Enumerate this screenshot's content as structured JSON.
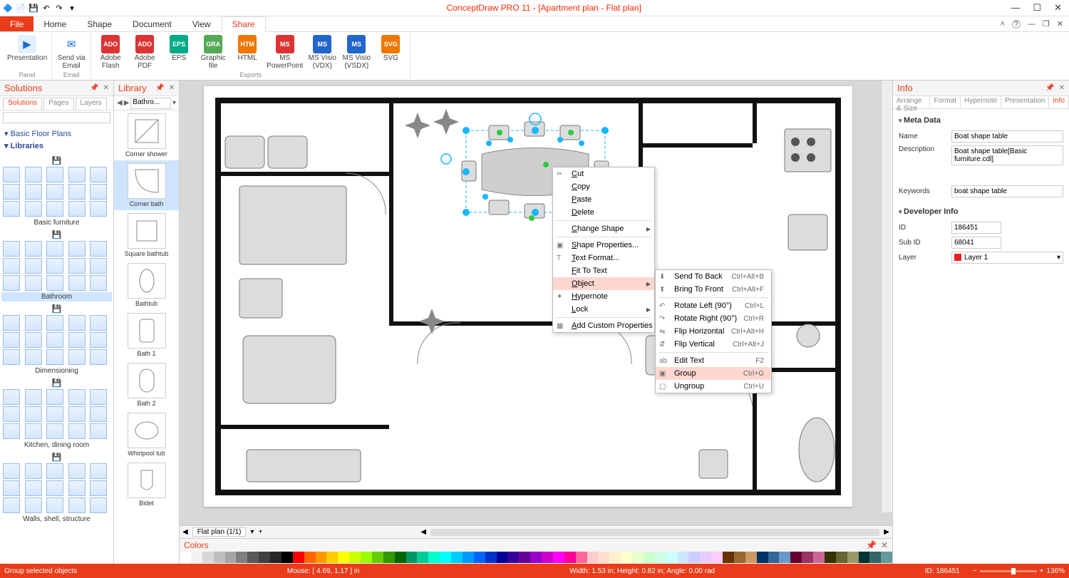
{
  "titlebar": {
    "title": "ConceptDraw PRO 11 - [Apartment plan - Flat plan]"
  },
  "tabs": {
    "file": "File",
    "items": [
      "Home",
      "Shape",
      "Document",
      "View",
      "Share"
    ],
    "active": "Share"
  },
  "ribbon": {
    "groups": [
      {
        "name": "Panel",
        "items": [
          {
            "label": "Presentation"
          }
        ]
      },
      {
        "name": "Email",
        "items": [
          {
            "label": "Send via\nEmail"
          }
        ]
      },
      {
        "name": "Exports",
        "items": [
          {
            "label": "Adobe\nFlash"
          },
          {
            "label": "Adobe\nPDF"
          },
          {
            "label": "EPS"
          },
          {
            "label": "Graphic\nfile"
          },
          {
            "label": "HTML"
          },
          {
            "label": "MS\nPowerPoint"
          },
          {
            "label": "MS Visio\n(VDX)"
          },
          {
            "label": "MS Visio\n(VSDX)"
          },
          {
            "label": "SVG"
          }
        ]
      }
    ]
  },
  "solutions": {
    "header": "Solutions",
    "subtabs": [
      "Solutions",
      "Pages",
      "Layers"
    ],
    "treeHead": "Basic Floor Plans",
    "treeLib": "Libraries",
    "sections": [
      "Basic furniture",
      "Bathroom",
      "Dimensioning",
      "Kitchen, dining room",
      "Walls, shell, structure"
    ],
    "selected": "Bathroom"
  },
  "library": {
    "header": "Library",
    "selector": "Bathro...",
    "items": [
      "Corner shower",
      "Corner bath",
      "Square bathtub",
      "Bathtub",
      "Bath 1",
      "Bath 2",
      "Whirlpool tub",
      "Bidet"
    ],
    "selected": "Corner bath"
  },
  "canvas": {
    "pageTab": "Flat plan (1/1)",
    "colorsHeader": "Colors"
  },
  "contextMenu": {
    "items": [
      {
        "k": "cut",
        "label": "Cut",
        "icon": "✂"
      },
      {
        "k": "copy",
        "label": "Copy"
      },
      {
        "k": "paste",
        "label": "Paste"
      },
      {
        "k": "delete",
        "label": "Delete"
      },
      {
        "sep": true
      },
      {
        "k": "change-shape",
        "label": "Change Shape",
        "arrow": true
      },
      {
        "sep": true
      },
      {
        "k": "shape-props",
        "label": "Shape Properties...",
        "icon": "▣"
      },
      {
        "k": "text-format",
        "label": "Text Format...",
        "icon": "T"
      },
      {
        "k": "fit-to-text",
        "label": "Fit To Text"
      },
      {
        "k": "object",
        "label": "Object",
        "arrow": true,
        "hl": true
      },
      {
        "k": "hypernote",
        "label": "Hypernote",
        "icon": "✦"
      },
      {
        "k": "lock",
        "label": "Lock",
        "arrow": true
      },
      {
        "sep": true
      },
      {
        "k": "add-custom",
        "label": "Add Custom Properties",
        "icon": "▦"
      }
    ],
    "submenu": [
      {
        "k": "send-back",
        "label": "Send To Back",
        "shortcut": "Ctrl+Alt+B"
      },
      {
        "k": "bring-front",
        "label": "Bring To Front",
        "shortcut": "Ctrl+Alt+F"
      },
      {
        "sep": true
      },
      {
        "k": "rotate-left",
        "label": "Rotate Left (90°)",
        "shortcut": "Ctrl+L"
      },
      {
        "k": "rotate-right",
        "label": "Rotate Right (90°)",
        "shortcut": "Ctrl+R"
      },
      {
        "k": "flip-h",
        "label": "Flip Horizontal",
        "shortcut": "Ctrl+Alt+H"
      },
      {
        "k": "flip-v",
        "label": "Flip Vertical",
        "shortcut": "Ctrl+Alt+J"
      },
      {
        "sep": true
      },
      {
        "k": "edit-text",
        "label": "Edit Text",
        "shortcut": "F2"
      },
      {
        "k": "group",
        "label": "Group",
        "shortcut": "Ctrl+G",
        "hl": true
      },
      {
        "k": "ungroup",
        "label": "Ungroup",
        "shortcut": "Ctrl+U"
      }
    ]
  },
  "info": {
    "header": "Info",
    "subtabs": [
      "Arrange & Size",
      "Format",
      "Hypernote",
      "Presentation",
      "Info"
    ],
    "metaHead": "Meta Data",
    "nameLabel": "Name",
    "nameValue": "Boat shape table",
    "descLabel": "Description",
    "descValue": "Boat shape table[Basic furniture.cdl]",
    "kwLabel": "Keywords",
    "kwValue": "boat shape table",
    "devHead": "Developer Info",
    "idLabel": "ID",
    "idValue": "186451",
    "subIdLabel": "Sub ID",
    "subIdValue": "68041",
    "layerLabel": "Layer",
    "layerValue": "Layer 1"
  },
  "status": {
    "left": "Group selected objects",
    "mouse": "Mouse: [ 4.69, 1.17 ] in",
    "dims": "Width: 1.53 in;   Height: 0.82 in;   Angle: 0.00 rad",
    "id": "ID: 186451",
    "zoom": "136%"
  },
  "colors": [
    "#ffffff",
    "#f2f2f2",
    "#d8d8d8",
    "#bfbfbf",
    "#a6a6a6",
    "#7f7f7f",
    "#595959",
    "#3f3f3f",
    "#262626",
    "#000000",
    "#ff0000",
    "#ff6600",
    "#ff9900",
    "#ffcc00",
    "#ffff00",
    "#ccff00",
    "#99ff00",
    "#66cc00",
    "#339900",
    "#006600",
    "#009966",
    "#00cc99",
    "#00ffcc",
    "#00ffff",
    "#00ccff",
    "#0099ff",
    "#0066ff",
    "#0033cc",
    "#000099",
    "#330099",
    "#660099",
    "#9900cc",
    "#cc00cc",
    "#ff00ff",
    "#ff0099",
    "#ff6699",
    "#ffcccc",
    "#ffe0cc",
    "#fff0cc",
    "#ffffcc",
    "#e6ffcc",
    "#ccffcc",
    "#ccffe6",
    "#ccffff",
    "#cce6ff",
    "#ccccff",
    "#e6ccff",
    "#ffccff",
    "#663300",
    "#996633",
    "#cc9966",
    "#003366",
    "#336699",
    "#6699cc",
    "#660033",
    "#993366",
    "#cc6699",
    "#333300",
    "#666633",
    "#999966",
    "#003333",
    "#336666",
    "#669999"
  ]
}
